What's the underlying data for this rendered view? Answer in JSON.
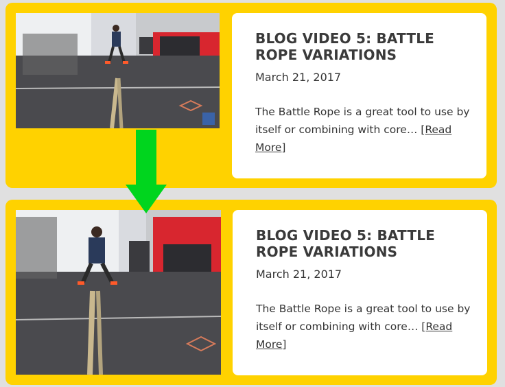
{
  "posts": [
    {
      "title": "BLOG VIDEO 5: BATTLE ROPE VARIATIONS",
      "date": "March 21, 2017",
      "excerpt": "The Battle Rope is a great tool to use by itself or combining with core…",
      "read_more": "[Read More]"
    },
    {
      "title": "BLOG VIDEO 5: BATTLE ROPE VARIATIONS",
      "date": "March 21, 2017",
      "excerpt": "The Battle Rope is a great tool to use by itself or combining with core…",
      "read_more": "[Read More]"
    }
  ],
  "arrow": {
    "color": "#00d51e",
    "icon": "down-arrow-icon"
  },
  "colors": {
    "card_bg": "#ffd200",
    "page_bg": "#e0e0e0"
  }
}
